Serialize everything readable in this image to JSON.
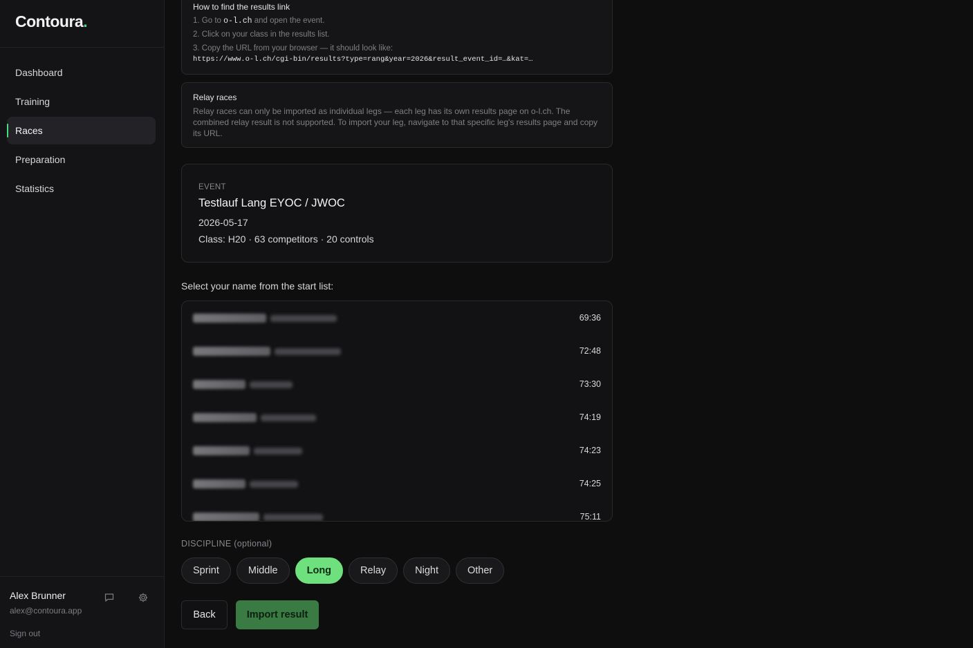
{
  "app": {
    "logo_text": "Contoura",
    "logo_dot": ".",
    "accent_color": "#4ade80"
  },
  "sidebar": {
    "items": [
      {
        "label": "Dashboard",
        "active": false
      },
      {
        "label": "Training",
        "active": false
      },
      {
        "label": "Races",
        "active": true
      },
      {
        "label": "Preparation",
        "active": false
      },
      {
        "label": "Statistics",
        "active": false
      }
    ],
    "user": {
      "name": "Alex Brunner",
      "email": "alex@contoura.app",
      "sign_out_label": "Sign out",
      "icons": [
        "chat-icon",
        "gear-icon"
      ]
    }
  },
  "howto": {
    "title": "How to find the results link",
    "step1_prefix": "1. Go to ",
    "step1_domain": "o-l.ch",
    "step1_suffix": " and open the event.",
    "step2": "2. Click on your class in the results list.",
    "step3": "3. Copy the URL from your browser — it should look like:",
    "example_url": "https://www.o-l.ch/cgi-bin/results?type=rang&year=2026&result_event_id=…&kat=…"
  },
  "relay": {
    "title": "Relay races",
    "body": "Relay races can only be imported as individual legs — each leg has its own results page on o-l.ch. The combined relay result is not supported. To import your leg, navigate to that specific leg's results page and copy its URL."
  },
  "event": {
    "label": "EVENT",
    "name": "Testlauf Lang EYOC / JWOC",
    "date": "2026-05-17",
    "meta": "Class: H20 · 63 competitors · 20 controls"
  },
  "start_list": {
    "label": "Select your name from the start list:",
    "rows": [
      {
        "time": "69:36"
      },
      {
        "time": "72:48"
      },
      {
        "time": "73:30"
      },
      {
        "time": "74:19"
      },
      {
        "time": "74:23"
      },
      {
        "time": "74:25"
      },
      {
        "time": "75:11"
      }
    ]
  },
  "discipline": {
    "label": "DISCIPLINE (optional)",
    "options": [
      {
        "label": "Sprint",
        "active": false
      },
      {
        "label": "Middle",
        "active": false
      },
      {
        "label": "Long",
        "active": true
      },
      {
        "label": "Relay",
        "active": false
      },
      {
        "label": "Night",
        "active": false
      },
      {
        "label": "Other",
        "active": false
      }
    ]
  },
  "actions": {
    "back_label": "Back",
    "import_label": "Import result"
  }
}
